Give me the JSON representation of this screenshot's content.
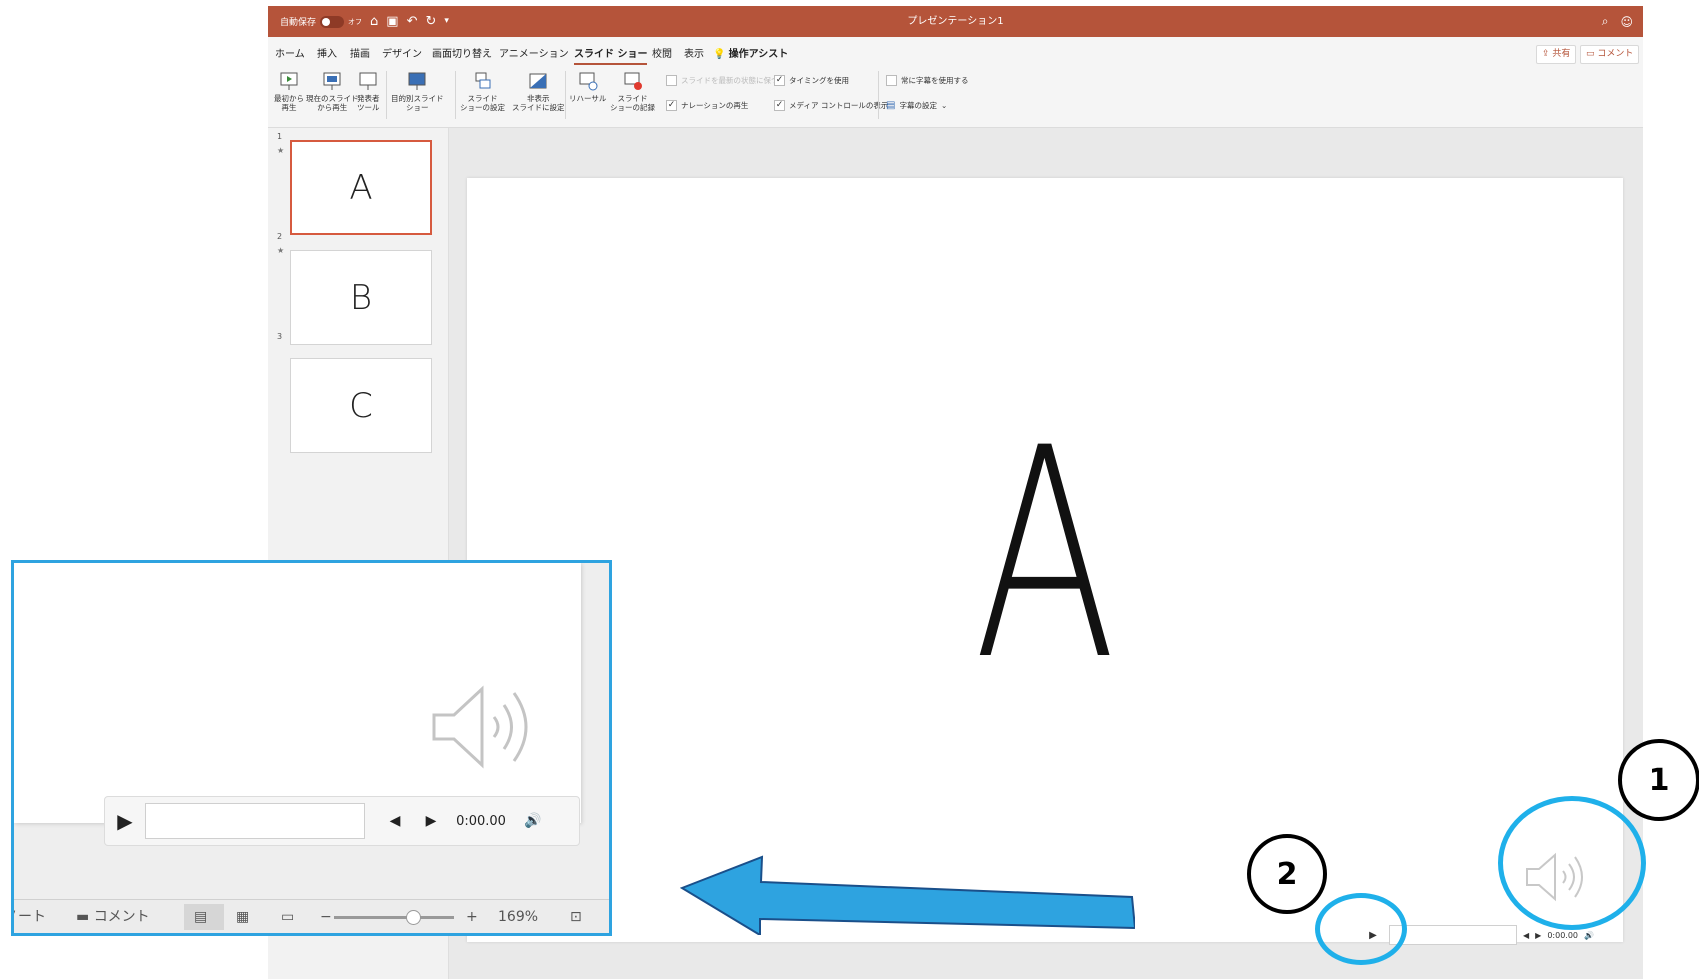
{
  "titlebar": {
    "autosave_label": "自動保存",
    "autosave_state": "オフ",
    "doc_title": "プレゼンテーション1",
    "icons": [
      "home-icon",
      "save-icon",
      "undo-icon",
      "redo-icon",
      "customize-icon",
      "search-icon",
      "smiley-icon"
    ]
  },
  "tabs": [
    "ホーム",
    "挿入",
    "描画",
    "デザイン",
    "画面切り替え",
    "アニメーション",
    "スライド ショー",
    "校閲",
    "表示"
  ],
  "active_tab": "スライド ショー",
  "assist_label": "操作アシスト",
  "share_label": "共有",
  "comment_label": "コメント",
  "ribbon": {
    "from_beginning": [
      "最初から",
      "再生"
    ],
    "from_current": [
      "現在のスライド",
      "から再生"
    ],
    "presenter_tools": [
      "発表者",
      "ツール"
    ],
    "custom_show": [
      "目的別スライド",
      "ショー"
    ],
    "setup_show": [
      "スライド",
      "ショーの設定"
    ],
    "hide_slide": [
      "非表示",
      "スライドに設定"
    ],
    "rehearse": "リハーサル",
    "record_show": [
      "スライド",
      "ショーの記録"
    ],
    "chk_keep_updated": "スライドを最新の状態に保つ",
    "chk_timings": "タイミングを使用",
    "chk_narration": "ナレーションの再生",
    "chk_media_controls": "メディア コントロールの表示",
    "chk_subtitles": "常に字幕を使用する",
    "subtitle_settings": "字幕の設定"
  },
  "slides": [
    {
      "num": "1",
      "star": "★",
      "letter": "A"
    },
    {
      "num": "2",
      "star": "★",
      "letter": "B"
    },
    {
      "num": "3",
      "star": "",
      "letter": "C"
    }
  ],
  "main_slide_letter": "A",
  "media": {
    "time": "0:00.00"
  },
  "zoom": {
    "time": "0:00.00",
    "notes_label": "ノート",
    "comment_label": "コメント",
    "zoom_level": "169%"
  },
  "annotations": {
    "label_1": "1",
    "label_2": "2"
  },
  "colors": {
    "titlebar": "#b5543a",
    "highlight_blue": "#1fb0ea",
    "arrow_blue": "#2ea3e0"
  }
}
